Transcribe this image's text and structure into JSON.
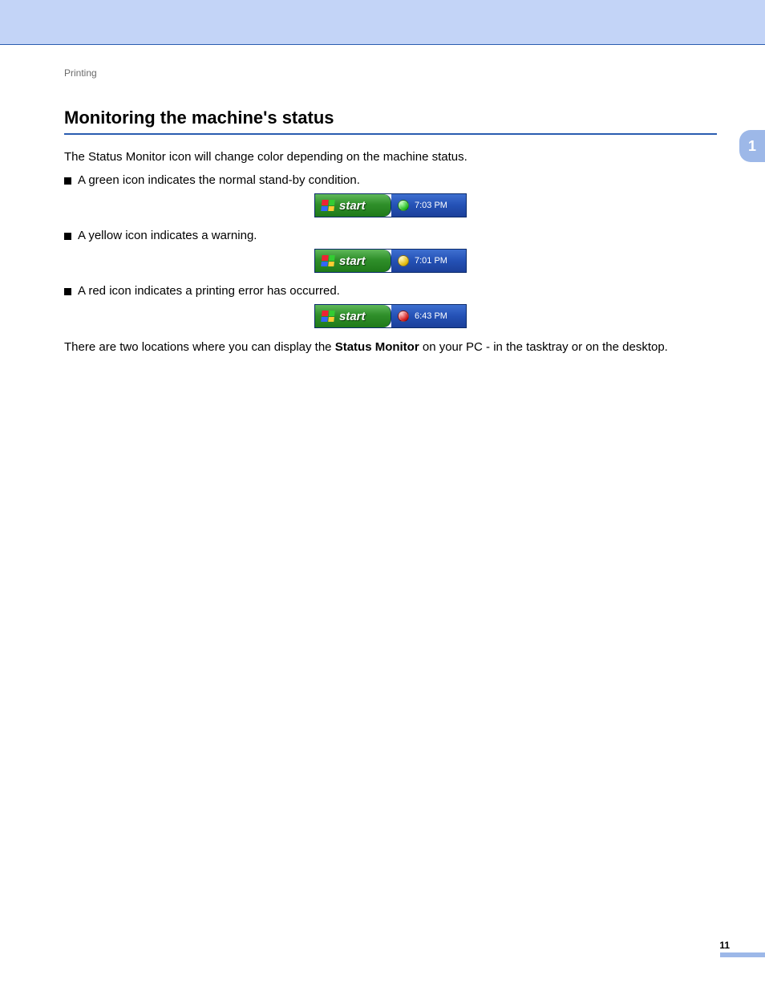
{
  "header": {
    "breadcrumb": "Printing"
  },
  "chapter": {
    "number": "1"
  },
  "section": {
    "title": "Monitoring the machine's status",
    "intro": "The Status Monitor icon will change color depending on the machine status."
  },
  "bullets": [
    {
      "text": "A green icon indicates the normal stand-by condition.",
      "dotClass": "dot-green",
      "time": "7:03 PM"
    },
    {
      "text": "A yellow icon indicates a warning.",
      "dotClass": "dot-yellow",
      "time": "7:01 PM"
    },
    {
      "text": "A red icon indicates a printing error has occurred.",
      "dotClass": "dot-red",
      "time": "6:43 PM"
    }
  ],
  "startLabel": "start",
  "closing": {
    "pre": "There are two locations where you can display the ",
    "bold": "Status Monitor",
    "post": " on your PC - in the tasktray or on the desktop."
  },
  "page": {
    "number": "11"
  }
}
